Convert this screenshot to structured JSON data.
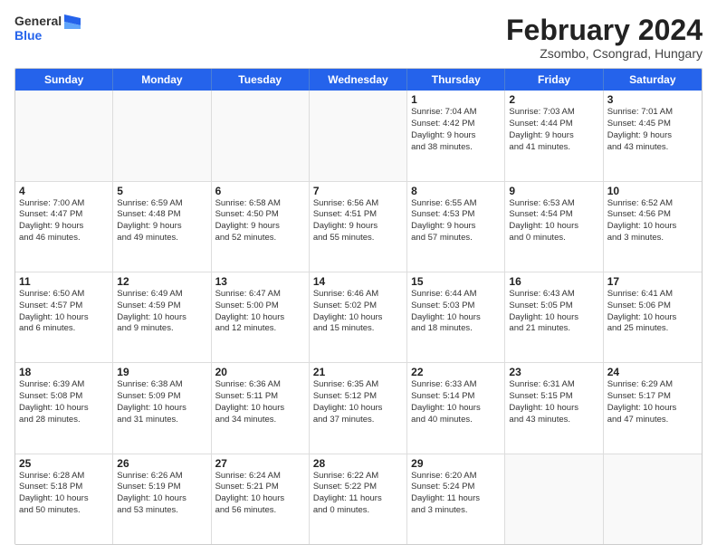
{
  "header": {
    "logo": {
      "general": "General",
      "blue": "Blue"
    },
    "title": "February 2024",
    "subtitle": "Zsombo, Csongrad, Hungary"
  },
  "days_of_week": [
    "Sunday",
    "Monday",
    "Tuesday",
    "Wednesday",
    "Thursday",
    "Friday",
    "Saturday"
  ],
  "weeks": [
    [
      {
        "day": "",
        "info": "",
        "empty": true
      },
      {
        "day": "",
        "info": "",
        "empty": true
      },
      {
        "day": "",
        "info": "",
        "empty": true
      },
      {
        "day": "",
        "info": "",
        "empty": true
      },
      {
        "day": "1",
        "info": "Sunrise: 7:04 AM\nSunset: 4:42 PM\nDaylight: 9 hours\nand 38 minutes.",
        "empty": false
      },
      {
        "day": "2",
        "info": "Sunrise: 7:03 AM\nSunset: 4:44 PM\nDaylight: 9 hours\nand 41 minutes.",
        "empty": false
      },
      {
        "day": "3",
        "info": "Sunrise: 7:01 AM\nSunset: 4:45 PM\nDaylight: 9 hours\nand 43 minutes.",
        "empty": false
      }
    ],
    [
      {
        "day": "4",
        "info": "Sunrise: 7:00 AM\nSunset: 4:47 PM\nDaylight: 9 hours\nand 46 minutes.",
        "empty": false
      },
      {
        "day": "5",
        "info": "Sunrise: 6:59 AM\nSunset: 4:48 PM\nDaylight: 9 hours\nand 49 minutes.",
        "empty": false
      },
      {
        "day": "6",
        "info": "Sunrise: 6:58 AM\nSunset: 4:50 PM\nDaylight: 9 hours\nand 52 minutes.",
        "empty": false
      },
      {
        "day": "7",
        "info": "Sunrise: 6:56 AM\nSunset: 4:51 PM\nDaylight: 9 hours\nand 55 minutes.",
        "empty": false
      },
      {
        "day": "8",
        "info": "Sunrise: 6:55 AM\nSunset: 4:53 PM\nDaylight: 9 hours\nand 57 minutes.",
        "empty": false
      },
      {
        "day": "9",
        "info": "Sunrise: 6:53 AM\nSunset: 4:54 PM\nDaylight: 10 hours\nand 0 minutes.",
        "empty": false
      },
      {
        "day": "10",
        "info": "Sunrise: 6:52 AM\nSunset: 4:56 PM\nDaylight: 10 hours\nand 3 minutes.",
        "empty": false
      }
    ],
    [
      {
        "day": "11",
        "info": "Sunrise: 6:50 AM\nSunset: 4:57 PM\nDaylight: 10 hours\nand 6 minutes.",
        "empty": false
      },
      {
        "day": "12",
        "info": "Sunrise: 6:49 AM\nSunset: 4:59 PM\nDaylight: 10 hours\nand 9 minutes.",
        "empty": false
      },
      {
        "day": "13",
        "info": "Sunrise: 6:47 AM\nSunset: 5:00 PM\nDaylight: 10 hours\nand 12 minutes.",
        "empty": false
      },
      {
        "day": "14",
        "info": "Sunrise: 6:46 AM\nSunset: 5:02 PM\nDaylight: 10 hours\nand 15 minutes.",
        "empty": false
      },
      {
        "day": "15",
        "info": "Sunrise: 6:44 AM\nSunset: 5:03 PM\nDaylight: 10 hours\nand 18 minutes.",
        "empty": false
      },
      {
        "day": "16",
        "info": "Sunrise: 6:43 AM\nSunset: 5:05 PM\nDaylight: 10 hours\nand 21 minutes.",
        "empty": false
      },
      {
        "day": "17",
        "info": "Sunrise: 6:41 AM\nSunset: 5:06 PM\nDaylight: 10 hours\nand 25 minutes.",
        "empty": false
      }
    ],
    [
      {
        "day": "18",
        "info": "Sunrise: 6:39 AM\nSunset: 5:08 PM\nDaylight: 10 hours\nand 28 minutes.",
        "empty": false
      },
      {
        "day": "19",
        "info": "Sunrise: 6:38 AM\nSunset: 5:09 PM\nDaylight: 10 hours\nand 31 minutes.",
        "empty": false
      },
      {
        "day": "20",
        "info": "Sunrise: 6:36 AM\nSunset: 5:11 PM\nDaylight: 10 hours\nand 34 minutes.",
        "empty": false
      },
      {
        "day": "21",
        "info": "Sunrise: 6:35 AM\nSunset: 5:12 PM\nDaylight: 10 hours\nand 37 minutes.",
        "empty": false
      },
      {
        "day": "22",
        "info": "Sunrise: 6:33 AM\nSunset: 5:14 PM\nDaylight: 10 hours\nand 40 minutes.",
        "empty": false
      },
      {
        "day": "23",
        "info": "Sunrise: 6:31 AM\nSunset: 5:15 PM\nDaylight: 10 hours\nand 43 minutes.",
        "empty": false
      },
      {
        "day": "24",
        "info": "Sunrise: 6:29 AM\nSunset: 5:17 PM\nDaylight: 10 hours\nand 47 minutes.",
        "empty": false
      }
    ],
    [
      {
        "day": "25",
        "info": "Sunrise: 6:28 AM\nSunset: 5:18 PM\nDaylight: 10 hours\nand 50 minutes.",
        "empty": false
      },
      {
        "day": "26",
        "info": "Sunrise: 6:26 AM\nSunset: 5:19 PM\nDaylight: 10 hours\nand 53 minutes.",
        "empty": false
      },
      {
        "day": "27",
        "info": "Sunrise: 6:24 AM\nSunset: 5:21 PM\nDaylight: 10 hours\nand 56 minutes.",
        "empty": false
      },
      {
        "day": "28",
        "info": "Sunrise: 6:22 AM\nSunset: 5:22 PM\nDaylight: 11 hours\nand 0 minutes.",
        "empty": false
      },
      {
        "day": "29",
        "info": "Sunrise: 6:20 AM\nSunset: 5:24 PM\nDaylight: 11 hours\nand 3 minutes.",
        "empty": false
      },
      {
        "day": "",
        "info": "",
        "empty": true
      },
      {
        "day": "",
        "info": "",
        "empty": true
      }
    ]
  ]
}
